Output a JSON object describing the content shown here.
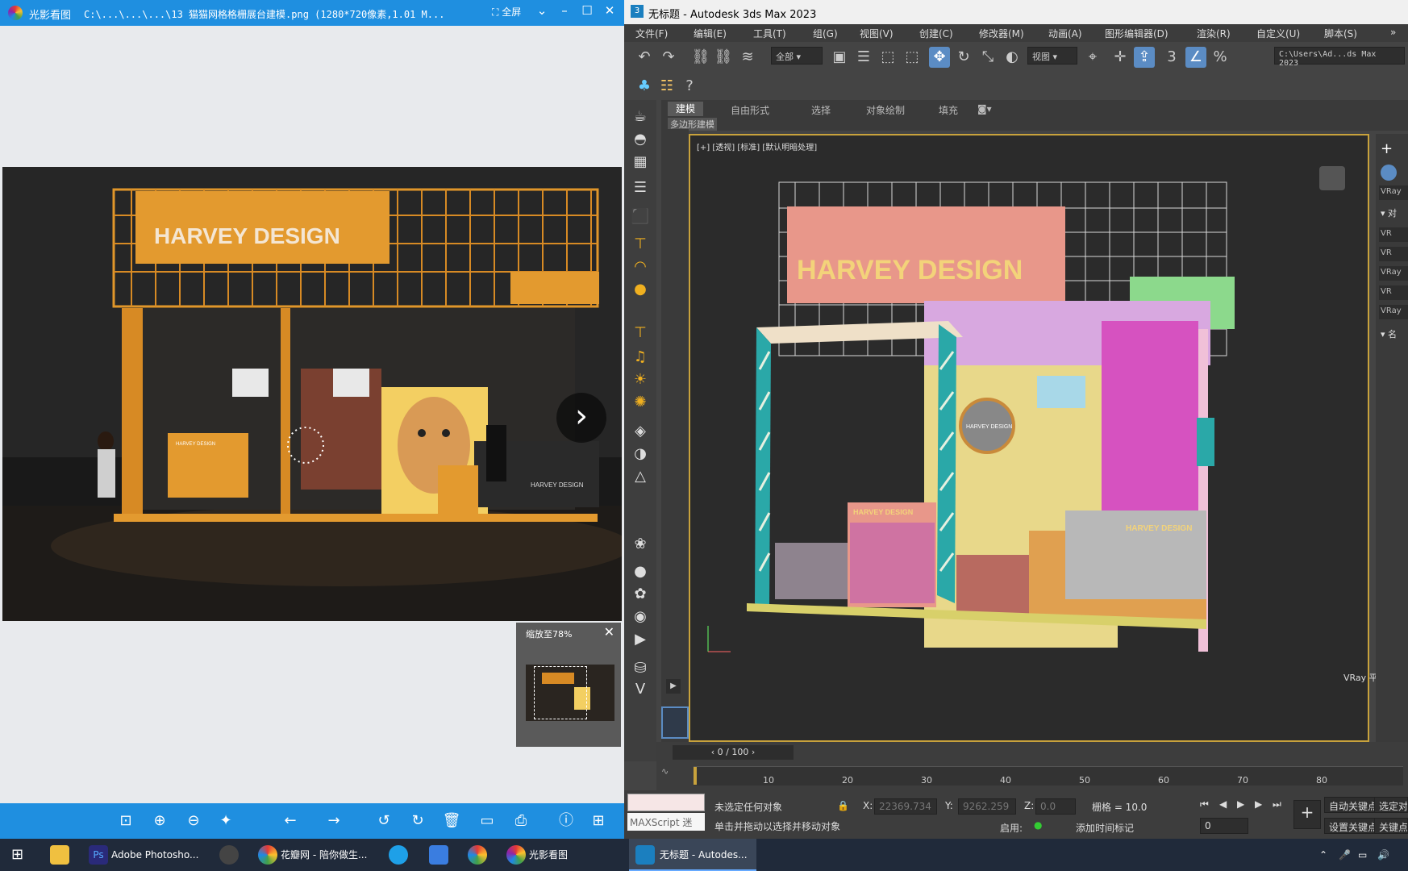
{
  "viewer": {
    "app_name": "光影看图",
    "file_path": "C:\\...\\...\\...\\13 猫猫网格格栅展台建模.png (1280*720像素,1.01 M...",
    "fullscreen_label": "全屏",
    "zoom_label": "缩放至78%",
    "next_glyph": "›",
    "photo_sign": "HARVEY DESIGN",
    "photo_counter": "HARVEY DESIGN",
    "photo_shop": "HARVEY DESIGN"
  },
  "max": {
    "title": "无标题 - Autodesk 3ds Max 2023",
    "menu": [
      "文件(F)",
      "编辑(E)",
      "工具(T)",
      "组(G)",
      "视图(V)",
      "创建(C)",
      "修改器(M)",
      "动画(A)",
      "图形编辑器(D)",
      "渲染(R)",
      "自定义(U)",
      "脚本(S)"
    ],
    "selection_filter": "全部",
    "ref_coord": "视图",
    "project_path": "C:\\Users\\Ad...ds Max 2023",
    "ribbon_tabs": [
      "建模",
      "自由形式",
      "选择",
      "对象绘制",
      "填充"
    ],
    "ribbon_sub": "多边形建模",
    "viewport_label": "[+] [透视] [标准] [默认明暗处理]",
    "vray_label": "VRay 平面",
    "model_sign": "HARVEY DESIGN",
    "model_small": "HARVEY DESIGN",
    "model_counter": "HARVEY DESIGN",
    "model_circle": "HARVEY DESIGN",
    "right_panel": [
      "VRay",
      "VR",
      "VR",
      "VRay",
      "VR",
      "VRay"
    ],
    "right_sections": [
      "对",
      "名"
    ],
    "frame": "0 / 100",
    "ruler": [
      "10",
      "20",
      "30",
      "40",
      "50",
      "60",
      "70",
      "80"
    ],
    "maxscript": "MAXScript 迷",
    "status1": "未选定任何对象",
    "status2": "单击并拖动以选择并移动对象",
    "x_label": "X:",
    "x_val": "22369.734",
    "y_label": "Y:",
    "y_val": "9262.259",
    "z_label": "Z:",
    "z_val": "0.0",
    "grid": "栅格 = 10.0",
    "enable": "启用:",
    "add_tag": "添加时间标记",
    "autokey": "自动关键点",
    "selobj": "选定对象",
    "setkey": "设置关键点",
    "keyfilter": "关键点过滤",
    "frame_input": "0"
  },
  "taskbar": {
    "items": [
      "Adobe Photosho...",
      "花瓣网 - 陪你做生...",
      "光影看图",
      "无标题 - Autodes..."
    ]
  }
}
